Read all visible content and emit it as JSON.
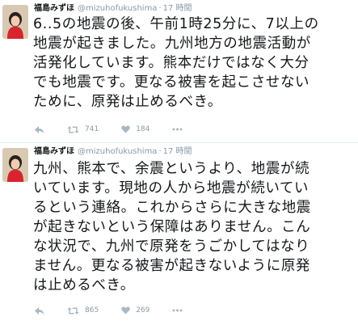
{
  "tweets": [
    {
      "author": {
        "name": "福島みずほ",
        "handle": "@mizuhofukushima"
      },
      "separator": "·",
      "time": "17 時間",
      "text": "6..5の地震の後、午前1時25分に、7以上の\n地震が起きました。九州地方の地震活動が\n活発化しています。熊本だけではなく大分\nでも地震です。更なる被害を起こさせない\nために、原発は止めるべき。",
      "actions": {
        "retweet_count": "741",
        "like_count": "184"
      }
    },
    {
      "author": {
        "name": "福島みずほ",
        "handle": "@mizuhofukushima"
      },
      "separator": "·",
      "time": "17 時間",
      "text": "九州、熊本で、余震というより、地震が続\nいています。現地の人から地震が続いてい\nるという連絡。これからさらに大きな地震\nが起きないという保障はありません。こん\nな状況で、九州で原発をうごかしてはなり\nません。更なる被害が起きないように原発\nは止めるべき。",
      "actions": {
        "retweet_count": "865",
        "like_count": "269"
      }
    }
  ],
  "icons": {
    "reply": "reply-icon",
    "retweet": "retweet-icon",
    "like": "heart-icon",
    "more": "more-icon"
  },
  "colors": {
    "icon": "#aab8c2",
    "meta": "#8899a6",
    "text": "#14171a"
  }
}
